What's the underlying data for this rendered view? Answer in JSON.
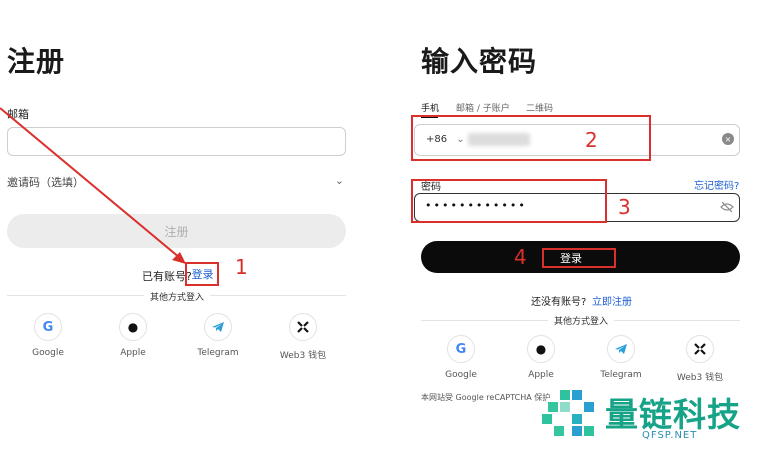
{
  "register_panel": {
    "title": "注册",
    "email_label": "邮箱",
    "invite_label": "邀请码（选填）",
    "register_button": "注册",
    "have_account": "已有账号?",
    "login_link": "登录",
    "other_methods": "其他方式登入",
    "socials": [
      {
        "label": "Google",
        "icon": "google-icon"
      },
      {
        "label": "Apple",
        "icon": "apple-icon"
      },
      {
        "label": "Telegram",
        "icon": "telegram-icon"
      },
      {
        "label": "Web3 钱包",
        "icon": "web3-wallet-icon"
      }
    ]
  },
  "password_panel": {
    "title": "输入密码",
    "tabs": [
      {
        "label": "手机",
        "active": true
      },
      {
        "label": "邮箱 / 子账户",
        "active": false
      },
      {
        "label": "二维码",
        "active": false
      }
    ],
    "country_code": "+86",
    "password_label": "密码",
    "forgot_link": "忘记密码?",
    "password_mask": "••••••••••••",
    "login_button": "登录",
    "no_account": "还没有账号?",
    "signup_link": "立即注册",
    "other_methods": "其他方式登入",
    "socials": [
      {
        "label": "Google",
        "icon": "google-icon"
      },
      {
        "label": "Apple",
        "icon": "apple-icon"
      },
      {
        "label": "Telegram",
        "icon": "telegram-icon"
      },
      {
        "label": "Web3 钱包",
        "icon": "web3-wallet-icon"
      }
    ],
    "recaptcha_note": "本网站受 Google reCAPTCHA 保护"
  },
  "annotations": {
    "step1": "1",
    "step2": "2",
    "step3": "3",
    "step4": "4",
    "color": "#d9302b"
  },
  "watermark": {
    "name": "量链科技",
    "domain": "QFSP.NET"
  },
  "colors": {
    "link": "#1c5fd1",
    "primary_button": "#0b0b0b",
    "disabled_button": "#ececec"
  }
}
